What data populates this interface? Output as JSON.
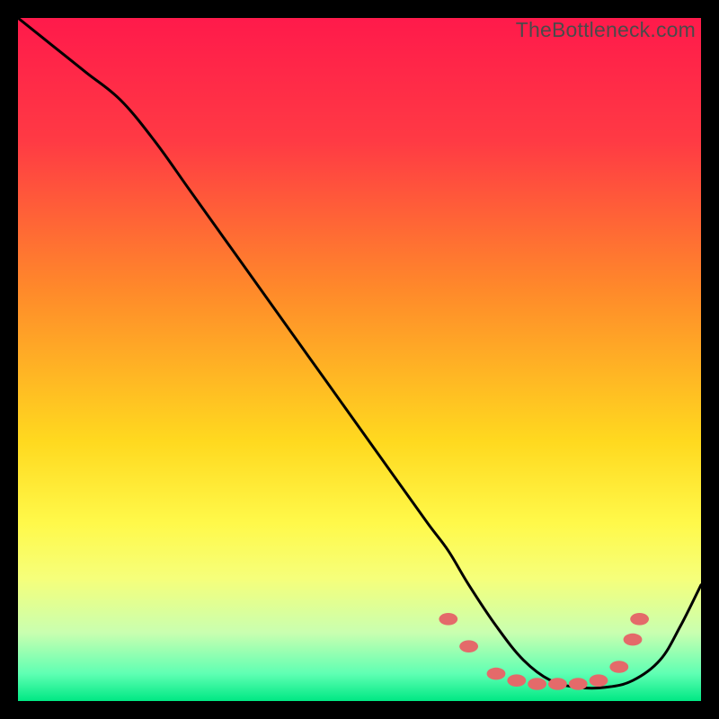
{
  "watermark": "TheBottleneck.com",
  "chart_data": {
    "type": "line",
    "title": "",
    "xlabel": "",
    "ylabel": "",
    "xlim": [
      0,
      100
    ],
    "ylim": [
      0,
      100
    ],
    "background_gradient_stops": [
      {
        "offset": 0,
        "color": "#ff1a4b"
      },
      {
        "offset": 18,
        "color": "#ff3a44"
      },
      {
        "offset": 40,
        "color": "#ff8a2a"
      },
      {
        "offset": 62,
        "color": "#ffd91f"
      },
      {
        "offset": 74,
        "color": "#fff94a"
      },
      {
        "offset": 82,
        "color": "#f6ff7a"
      },
      {
        "offset": 90,
        "color": "#c9ffb0"
      },
      {
        "offset": 96,
        "color": "#5fffb3"
      },
      {
        "offset": 100,
        "color": "#00e884"
      }
    ],
    "series": [
      {
        "name": "bottleneck-curve",
        "x": [
          0,
          5,
          10,
          15,
          20,
          25,
          30,
          35,
          40,
          45,
          50,
          55,
          60,
          63,
          66,
          70,
          74,
          78,
          82,
          86,
          90,
          94,
          97,
          100
        ],
        "y": [
          100,
          96,
          92,
          88,
          82,
          75,
          68,
          61,
          54,
          47,
          40,
          33,
          26,
          22,
          17,
          11,
          6,
          3,
          2,
          2,
          3,
          6,
          11,
          17
        ]
      }
    ],
    "markers": {
      "name": "highlight-dots",
      "color": "#e46a6a",
      "r": 8,
      "points": [
        {
          "x": 63,
          "y": 12
        },
        {
          "x": 66,
          "y": 8
        },
        {
          "x": 70,
          "y": 4
        },
        {
          "x": 73,
          "y": 3
        },
        {
          "x": 76,
          "y": 2.5
        },
        {
          "x": 79,
          "y": 2.5
        },
        {
          "x": 82,
          "y": 2.5
        },
        {
          "x": 85,
          "y": 3
        },
        {
          "x": 88,
          "y": 5
        },
        {
          "x": 90,
          "y": 9
        },
        {
          "x": 91,
          "y": 12
        }
      ]
    }
  }
}
